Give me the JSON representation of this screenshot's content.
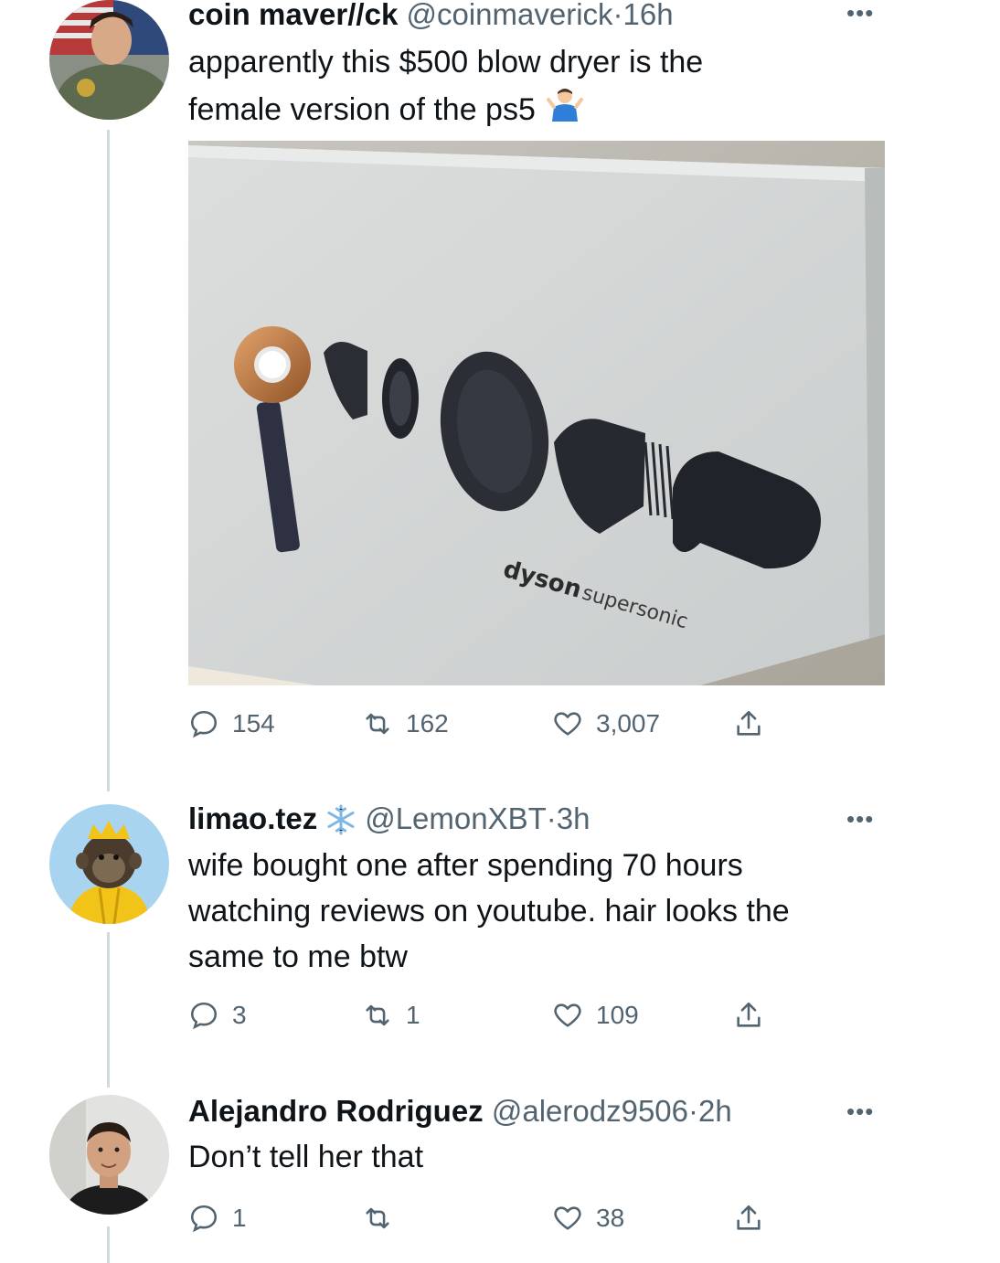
{
  "tweets": [
    {
      "name": "coin maver//ck",
      "handle": "@coinmaverick",
      "separator": "·",
      "time": "16h",
      "more_icon": "more-horizontal-icon",
      "text_line1": "apparently this $500 blow dryer is the",
      "text_line2": "female version of the ps5",
      "emoji": "person-shrugging-emoji",
      "media": {
        "brand": "dyson",
        "product": "supersonic"
      },
      "replies": "154",
      "retweets": "162",
      "likes": "3,007"
    },
    {
      "name": "limao.tez",
      "badge_icon": "snowflake-icon",
      "handle": "@LemonXBT",
      "separator": "·",
      "time": "3h",
      "more_icon": "more-horizontal-icon",
      "text_line1": "wife bought one after spending 70 hours",
      "text_line2": "watching reviews on youtube. hair looks the",
      "text_line3": "same to me btw",
      "replies": "3",
      "retweets": "1",
      "likes": "109"
    },
    {
      "name": "Alejandro Rodriguez",
      "handle": "@alerodz9506",
      "separator": "·",
      "time": "2h",
      "more_icon": "more-horizontal-icon",
      "text_line1": "Don’t tell her that",
      "replies": "1",
      "retweets": "",
      "likes": "38"
    }
  ],
  "colors": {
    "text": "#0f1419",
    "secondary": "#536471",
    "thread_line": "#cfd9de",
    "background": "#ffffff"
  }
}
